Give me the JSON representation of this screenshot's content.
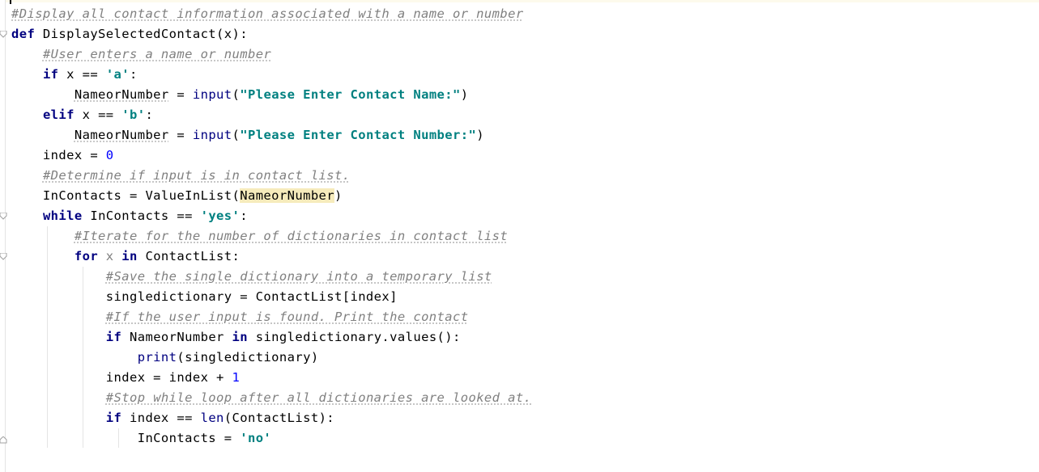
{
  "editor": {
    "lines": [
      [
        {
          "t": "#Display all contact information associated with a name or number",
          "c": "cm"
        }
      ],
      [
        {
          "t": "def",
          "c": "kw"
        },
        {
          "t": " DisplaySelectedContact(x):"
        }
      ],
      [
        {
          "t": "    "
        },
        {
          "t": "#User enters a name or number",
          "c": "cm"
        }
      ],
      [
        {
          "t": "    "
        },
        {
          "t": "if",
          "c": "kw"
        },
        {
          "t": " x == "
        },
        {
          "t": "'a'",
          "c": "str"
        },
        {
          "t": ":"
        }
      ],
      [
        {
          "t": "        "
        },
        {
          "t": "NameorNumber",
          "c": "ul"
        },
        {
          "t": " = "
        },
        {
          "t": "input",
          "c": "bi"
        },
        {
          "t": "("
        },
        {
          "t": "\"Please Enter Contact Name:\"",
          "c": "str"
        },
        {
          "t": ")"
        }
      ],
      [
        {
          "t": "    "
        },
        {
          "t": "elif",
          "c": "kw"
        },
        {
          "t": " x == "
        },
        {
          "t": "'b'",
          "c": "str"
        },
        {
          "t": ":"
        }
      ],
      [
        {
          "t": "        "
        },
        {
          "t": "NameorNumber",
          "c": "ul"
        },
        {
          "t": " = "
        },
        {
          "t": "input",
          "c": "bi"
        },
        {
          "t": "("
        },
        {
          "t": "\"Please Enter Contact Number:\"",
          "c": "str"
        },
        {
          "t": ")"
        }
      ],
      [
        {
          "t": "    index = "
        },
        {
          "t": "0",
          "c": "num"
        }
      ],
      [
        {
          "t": "    "
        },
        {
          "t": "#Determine if input is in contact list.",
          "c": "cm"
        }
      ],
      [
        {
          "t": "    InContacts = ValueInList("
        },
        {
          "t": "NameorNumber",
          "c": "hl"
        },
        {
          "t": ")"
        }
      ],
      [
        {
          "t": "    "
        },
        {
          "t": "while",
          "c": "kw"
        },
        {
          "t": " InContacts == "
        },
        {
          "t": "'yes'",
          "c": "str"
        },
        {
          "t": ":"
        }
      ],
      [
        {
          "t": "        "
        },
        {
          "t": "#Iterate for the number of dictionaries in contact list",
          "c": "cm"
        }
      ],
      [
        {
          "t": "        "
        },
        {
          "t": "for",
          "c": "kw"
        },
        {
          "t": " "
        },
        {
          "t": "x",
          "c": "unused"
        },
        {
          "t": " "
        },
        {
          "t": "in",
          "c": "kw"
        },
        {
          "t": " ContactList:"
        }
      ],
      [
        {
          "t": "            "
        },
        {
          "t": "#Save the single dictionary into a temporary list",
          "c": "cm"
        }
      ],
      [
        {
          "t": "            singledictionary = ContactList[index]"
        }
      ],
      [
        {
          "t": "            "
        },
        {
          "t": "#If the user input is found. Print the contact",
          "c": "cm"
        }
      ],
      [
        {
          "t": "            "
        },
        {
          "t": "if",
          "c": "kw"
        },
        {
          "t": " NameorNumber "
        },
        {
          "t": "in",
          "c": "kw"
        },
        {
          "t": " singledictionary.values():"
        }
      ],
      [
        {
          "t": "                "
        },
        {
          "t": "print",
          "c": "bi"
        },
        {
          "t": "(singledictionary)"
        }
      ],
      [
        {
          "t": "            index = index + "
        },
        {
          "t": "1",
          "c": "num"
        }
      ],
      [
        {
          "t": "            "
        },
        {
          "t": "#Stop while loop after all dictionaries are looked at.",
          "c": "cm"
        }
      ],
      [
        {
          "t": "            "
        },
        {
          "t": "if",
          "c": "kw"
        },
        {
          "t": " index == "
        },
        {
          "t": "len",
          "c": "bi"
        },
        {
          "t": "(ContactList):"
        }
      ],
      [
        {
          "t": "                InContacts = "
        },
        {
          "t": "'no'",
          "c": "str"
        }
      ]
    ]
  }
}
